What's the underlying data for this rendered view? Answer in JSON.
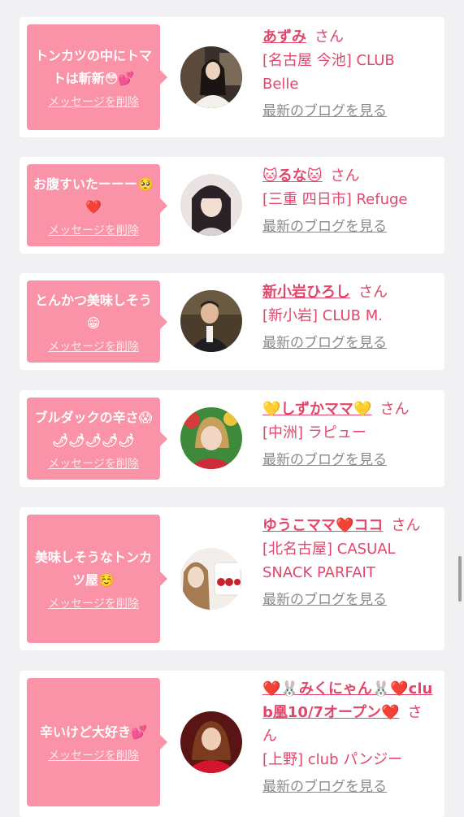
{
  "delete_label": "メッセージを削除",
  "blog_label": "最新のブログを見る",
  "honorific": "さん",
  "colors": {
    "page_bg": "#f1f1f3",
    "card_bg": "#ffffff",
    "bubble": "#fa93a7",
    "accent_text": "#e2466b",
    "link_gray": "#8a8a8a"
  },
  "entries": [
    {
      "message": "トンカツの中にトマトは斬新😳💕",
      "name": "あずみ",
      "shop": "[名古屋 今池] CLUB Belle"
    },
    {
      "message": "お腹すいたーーー🥺❤️",
      "name": "🐱るな🐱",
      "shop": "[三重 四日市] Refuge"
    },
    {
      "message": "とんかつ美味しそう😁",
      "name": "新小岩ひろし",
      "shop": "[新小岩] CLUB M."
    },
    {
      "message": "ブルダックの辛さ😱🌶🌶🌶🌶🌶",
      "name": "💛しずかママ💛",
      "shop": "[中洲] ラピュー"
    },
    {
      "message": "美味しそうなトンカツ屋☺️",
      "name": "ゆうこママ❤️ココ",
      "shop": "[北名古屋] CASUAL SNACK PARFAIT"
    },
    {
      "message": "辛いけど大好き💕",
      "name": "❤️🐰みくにゃん🐰❤️club凰10/7オープン❤️",
      "shop": "[上野] club パンジー"
    }
  ]
}
